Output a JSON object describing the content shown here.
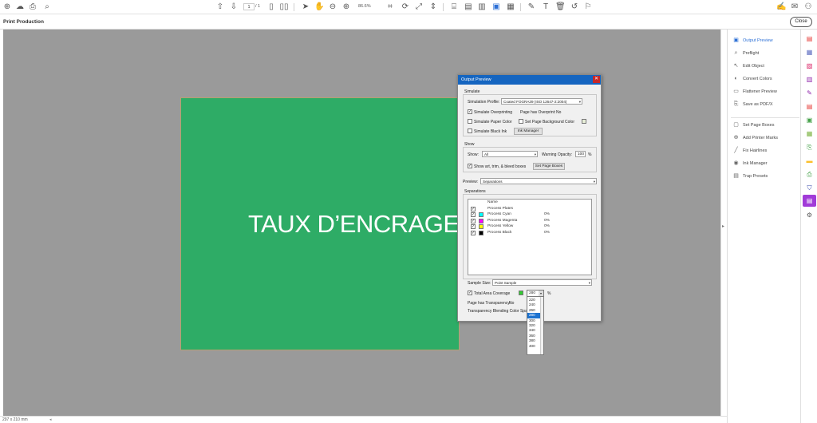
{
  "toolbar": {
    "page_current": "1",
    "page_total": "/ 1",
    "zoom": "86.6%"
  },
  "header": {
    "title": "Print Production",
    "close_label": "Close"
  },
  "document": {
    "headline": "TAUX D’ENCRAGE"
  },
  "status": {
    "page_size": "297 x 210 mm"
  },
  "panel": {
    "items": [
      {
        "label": "Output Preview",
        "icon": "output-preview-icon"
      },
      {
        "label": "Preflight",
        "icon": "preflight-icon"
      },
      {
        "label": "Edit Object",
        "icon": "edit-object-icon"
      },
      {
        "label": "Convert Colors",
        "icon": "convert-colors-icon"
      },
      {
        "label": "Flattener Preview",
        "icon": "flattener-preview-icon"
      },
      {
        "label": "Save as PDF/X",
        "icon": "save-pdfx-icon"
      },
      {
        "label": "Set Page Boxes",
        "icon": "page-boxes-icon"
      },
      {
        "label": "Add Printer Marks",
        "icon": "printer-marks-icon"
      },
      {
        "label": "Fix Hairlines",
        "icon": "hairlines-icon"
      },
      {
        "label": "Ink Manager",
        "icon": "ink-manager-icon"
      },
      {
        "label": "Trap Presets",
        "icon": "trap-presets-icon"
      }
    ]
  },
  "dialog": {
    "title": "Output Preview",
    "simulate_label": "Simulate",
    "sim_profile_label": "Simulation Profile:",
    "sim_profile_value": "Coated FOGRA39 (ISO 12647-2:2004)",
    "sim_overprint_label": "Simulate Overprinting",
    "page_overprint_label": "Page has Overprint:",
    "page_overprint_value": "No",
    "sim_paper_label": "Simulate Paper Color",
    "set_bg_label": "Set Page Background Color",
    "sim_black_label": "Simulate Black Ink",
    "ink_manager_btn": "Ink Manager",
    "show_group_label": "Show",
    "show_label": "Show:",
    "show_value": "All",
    "warning_opacity_label": "Warning Opacity:",
    "warning_opacity_value": "100",
    "percent": "%",
    "show_boxes_label": "Show art, trim, & bleed boxes",
    "set_page_boxes_btn": "Set Page Boxes",
    "preview_label": "Preview:",
    "preview_value": "Separations",
    "separations_label": "Separations",
    "name_col": "Name",
    "separations": [
      {
        "name": "Process Plates",
        "value": "",
        "color": ""
      },
      {
        "name": "Process Cyan",
        "value": "0%",
        "color": "#00ffff"
      },
      {
        "name": "Process Magenta",
        "value": "0%",
        "color": "#ff00ff"
      },
      {
        "name": "Process Yellow",
        "value": "0%",
        "color": "#ffff00"
      },
      {
        "name": "Process Black",
        "value": "0%",
        "color": "#000000"
      }
    ],
    "sample_size_label": "Sample Size:",
    "sample_size_value": "Point Sample",
    "tac_label": "Total Area Coverage",
    "tac_value": "280",
    "transparency_label": "Page has Transparency:",
    "transparency_value": "No",
    "blending_label": "Transparency Blending Color Space:"
  },
  "dropdown": {
    "options": [
      "220",
      "240",
      "260",
      "280",
      "300",
      "320",
      "340",
      "360",
      "380",
      "400"
    ],
    "selected": "280"
  },
  "colors": {
    "page_green": "#2eac66",
    "accent": "#2b6fd6",
    "selected_tool": "#a13bd8"
  }
}
